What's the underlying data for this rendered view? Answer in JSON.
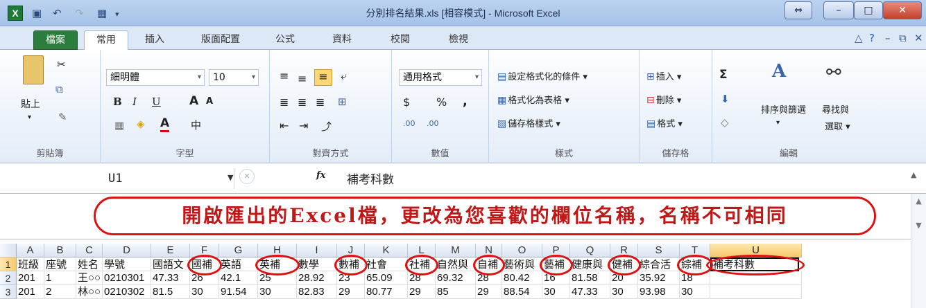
{
  "window": {
    "title": "分別排名結果.xls [相容模式] - Microsoft Excel",
    "logo": "X"
  },
  "tabs": {
    "file": "檔案",
    "items": [
      "常用",
      "插入",
      "版面配置",
      "公式",
      "資料",
      "校閱",
      "檢視"
    ]
  },
  "ribbon": {
    "clipboard": {
      "paste": "貼上",
      "label": "剪貼簿"
    },
    "font": {
      "name": "細明體",
      "size": "10",
      "bold": "B",
      "italic": "I",
      "underline": "U",
      "grow": "A",
      "shrink": "A",
      "phonetic": "中",
      "label": "字型"
    },
    "alignment": {
      "label": "對齊方式"
    },
    "number": {
      "format": "通用格式",
      "currency": "$",
      "percent": "%",
      "comma": ",",
      "inc_dec": ".00",
      "dec_dec": ".00",
      "label": "數值"
    },
    "styles": {
      "conditional": "設定格式化的條件",
      "table": "格式化為表格",
      "cell": "儲存格樣式",
      "label": "樣式"
    },
    "cells": {
      "insert": "插入",
      "delete": "刪除",
      "format": "格式",
      "label": "儲存格"
    },
    "editing": {
      "sigma": "Σ",
      "sort": "排序與篩選",
      "find": "尋找與",
      "find2": "選取",
      "label": "編輯"
    }
  },
  "formula_bar": {
    "name_box": "U1",
    "fx": "fx",
    "value": "補考科數"
  },
  "note": "開啟匯出的Excel檔，更改為您喜歡的欄位名稱，名稱不可相同",
  "sheet": {
    "columns": [
      "A",
      "B",
      "C",
      "D",
      "E",
      "F",
      "G",
      "H",
      "I",
      "J",
      "K",
      "L",
      "M",
      "N",
      "O",
      "P",
      "Q",
      "R",
      "S",
      "T",
      "U"
    ],
    "row_numbers": [
      "1",
      "2",
      "3"
    ],
    "rows": [
      [
        "班級",
        "座號",
        "姓名",
        "學號",
        "國語文",
        "國補",
        "英語",
        "英補",
        "數學",
        "數補",
        "社會",
        "社補",
        "自然與",
        "自補",
        "藝術與",
        "藝補",
        "健康與",
        "健補",
        "綜合活",
        "綜補",
        "補考科數"
      ],
      [
        "201",
        "1",
        "王○○",
        "0210301",
        "47.33",
        "26",
        "42.1",
        "25",
        "28.92",
        "23",
        "65.09",
        "28",
        "69.32",
        "28",
        "80.42",
        "16",
        "81.58",
        "20",
        "35.92",
        "18",
        ""
      ],
      [
        "201",
        "2",
        "林○○",
        "0210302",
        "81.5",
        "30",
        "91.54",
        "30",
        "82.83",
        "29",
        "80.77",
        "29",
        "85",
        "29",
        "88.54",
        "30",
        "47.33",
        "30",
        "93.98",
        "30",
        ""
      ]
    ]
  }
}
